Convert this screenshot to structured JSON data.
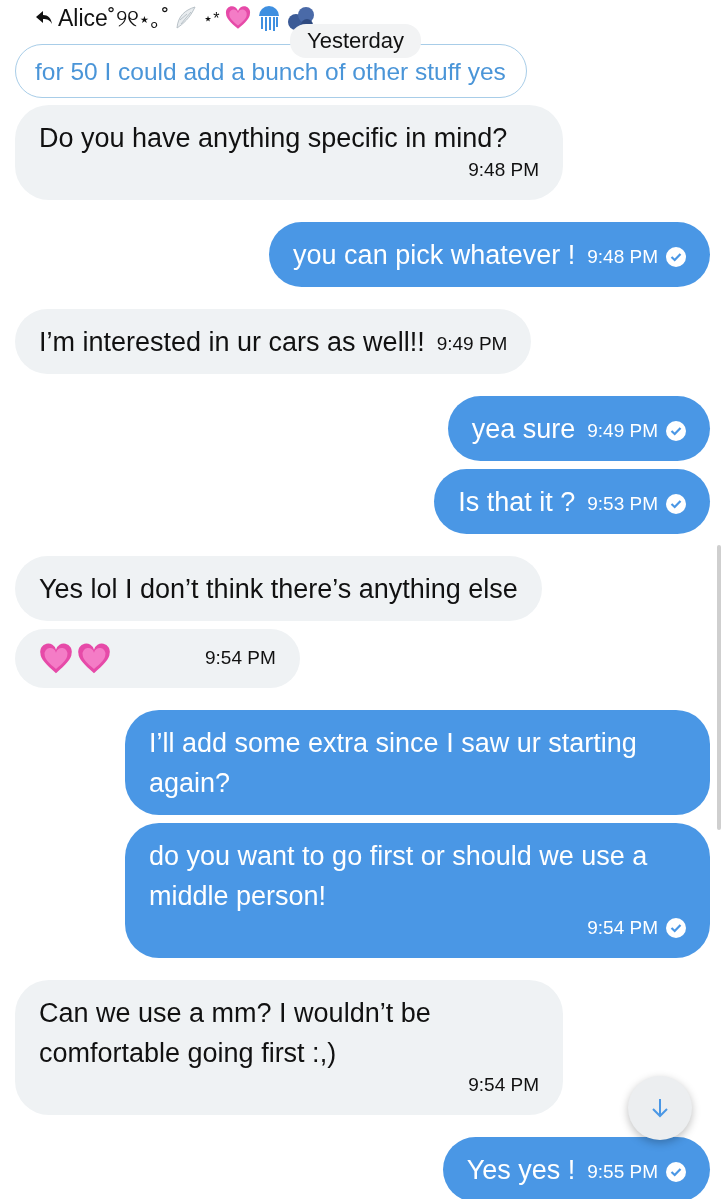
{
  "header": {
    "name": "Alice˚୨୧⋆｡˚",
    "decoration": "⋆*"
  },
  "quoted": {
    "text": "for 50 I could add a bunch of other stuff yes",
    "date_label": "Yesterday"
  },
  "messages": [
    {
      "kind": "text",
      "outgoing": false,
      "text": "Do you have anything specific in mind?",
      "time": "9:48 PM"
    },
    {
      "kind": "text",
      "outgoing": true,
      "text": "you can pick whatever !",
      "time": "9:48 PM",
      "read": true
    },
    {
      "kind": "text",
      "outgoing": false,
      "text": "I’m interested in ur cars as well!!",
      "time": "9:49 PM"
    },
    {
      "kind": "text",
      "outgoing": true,
      "text": "yea sure",
      "time": "9:49 PM",
      "read": true
    },
    {
      "kind": "text",
      "outgoing": true,
      "text": "Is that it ?",
      "time": "9:53 PM",
      "read": true
    },
    {
      "kind": "text",
      "outgoing": false,
      "text": "Yes lol I don’t think there’s anything else"
    },
    {
      "kind": "hearts",
      "outgoing": false,
      "time": "9:54 PM"
    },
    {
      "kind": "text",
      "outgoing": true,
      "text": "I’ll add some extra since I saw ur starting again?"
    },
    {
      "kind": "text",
      "outgoing": true,
      "text": "do you want to go first or should we use a middle person!",
      "time": "9:54 PM",
      "read": true
    },
    {
      "kind": "text",
      "outgoing": false,
      "text": "Can we use a mm? I wouldn’t be comfortable going first :,)",
      "time": "9:54 PM"
    },
    {
      "kind": "text",
      "outgoing": true,
      "text": "Yes yes !",
      "time": "9:55 PM",
      "read": true
    }
  ]
}
